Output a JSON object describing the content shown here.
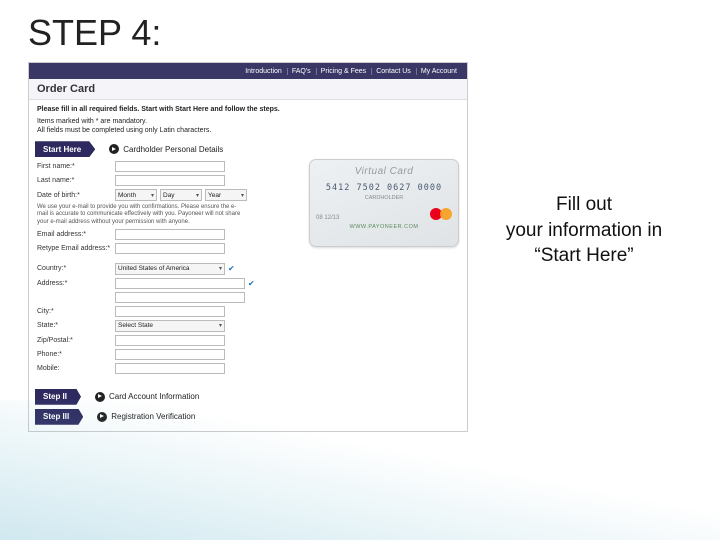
{
  "slide": {
    "title": "STEP 4:"
  },
  "side_note": {
    "line1": "Fill out",
    "line2": "your information in",
    "line3": "“Start Here”"
  },
  "nav": {
    "items": [
      "Introduction",
      "FAQ's",
      "Pricing & Fees",
      "Contact Us",
      "My Account"
    ]
  },
  "page": {
    "title": "Order Card",
    "inst_bold": "Please fill in all required fields. Start with Start Here and follow the steps.",
    "inst_sub_1": "Items marked with * are mandatory.",
    "inst_sub_2": "All fields must be completed using only Latin characters."
  },
  "sections": {
    "start": {
      "tab": "Start Here",
      "label": "Cardholder Personal Details"
    },
    "step2": {
      "tab": "Step II",
      "label": "Card Account Information"
    },
    "step3": {
      "tab": "Step III",
      "label": "Registration Verification"
    }
  },
  "form": {
    "first_name": "First name:*",
    "last_name": "Last name:*",
    "dob": "Date of birth:*",
    "dob_month": "Month",
    "dob_day": "Day",
    "dob_year": "Year",
    "email_note": "We use your e-mail to provide you with confirmations. Please ensure the e-mail is accurate to communicate effectively with you. Payoneer will not share your e-mail address without your permission with anyone.",
    "email": "Email address:*",
    "retype_email": "Retype Email address:*",
    "country": "Country:*",
    "country_val": "United States of America",
    "address": "Address:*",
    "city": "City:*",
    "state": "State:*",
    "state_val": "Select State",
    "zip": "Zip/Postal:*",
    "phone": "Phone:*",
    "mobile": "Mobile:"
  },
  "card": {
    "brand": "Virtual Card",
    "number": "5412 7502 0627 0000",
    "holder": "CARDHOLDER",
    "exp": "08 12/13",
    "url": "WWW.PAYONEER.COM"
  }
}
